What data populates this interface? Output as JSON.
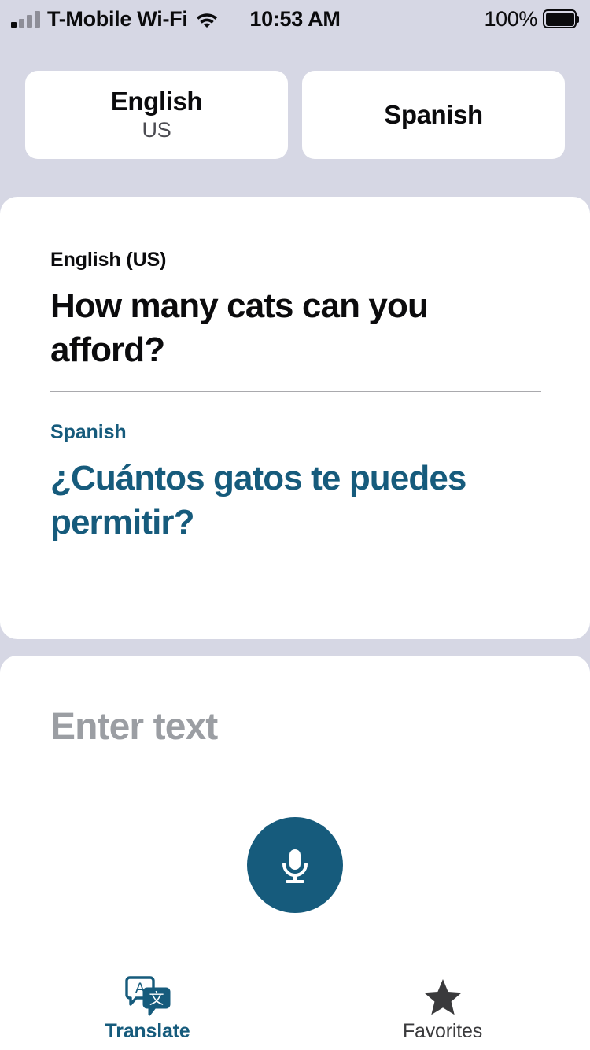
{
  "status_bar": {
    "carrier": "T-Mobile Wi-Fi",
    "time": "10:53 AM",
    "battery_percent": "100%",
    "signal_icon": "cellular-signal-icon",
    "wifi_icon": "wifi-icon",
    "battery_icon": "battery-full-icon"
  },
  "language_selector": {
    "source": {
      "name": "English",
      "region": "US"
    },
    "target": {
      "name": "Spanish",
      "region": ""
    }
  },
  "result_card": {
    "source": {
      "language_label": "English (US)",
      "text": "How many cats can you afford?"
    },
    "target": {
      "language_label": "Spanish",
      "text": "¿Cuántos gatos te puedes permitir?"
    },
    "actions": {
      "favorite_icon": "star-outline-icon",
      "dictionary_icon": "book-icon",
      "play_icon": "play-icon"
    }
  },
  "input_card": {
    "placeholder": "Enter text",
    "microphone_icon": "microphone-icon"
  },
  "tab_bar": {
    "tabs": [
      {
        "label": "Translate",
        "icon": "translate-icon",
        "active": true
      },
      {
        "label": "Favorites",
        "icon": "star-filled-icon",
        "active": false
      }
    ]
  },
  "colors": {
    "background": "#d6d7e4",
    "card": "#ffffff",
    "accent": "#165b7c",
    "placeholder": "#9b9ea3",
    "text": "#0b0b0d",
    "inactive_tab": "#3a3a3c"
  }
}
